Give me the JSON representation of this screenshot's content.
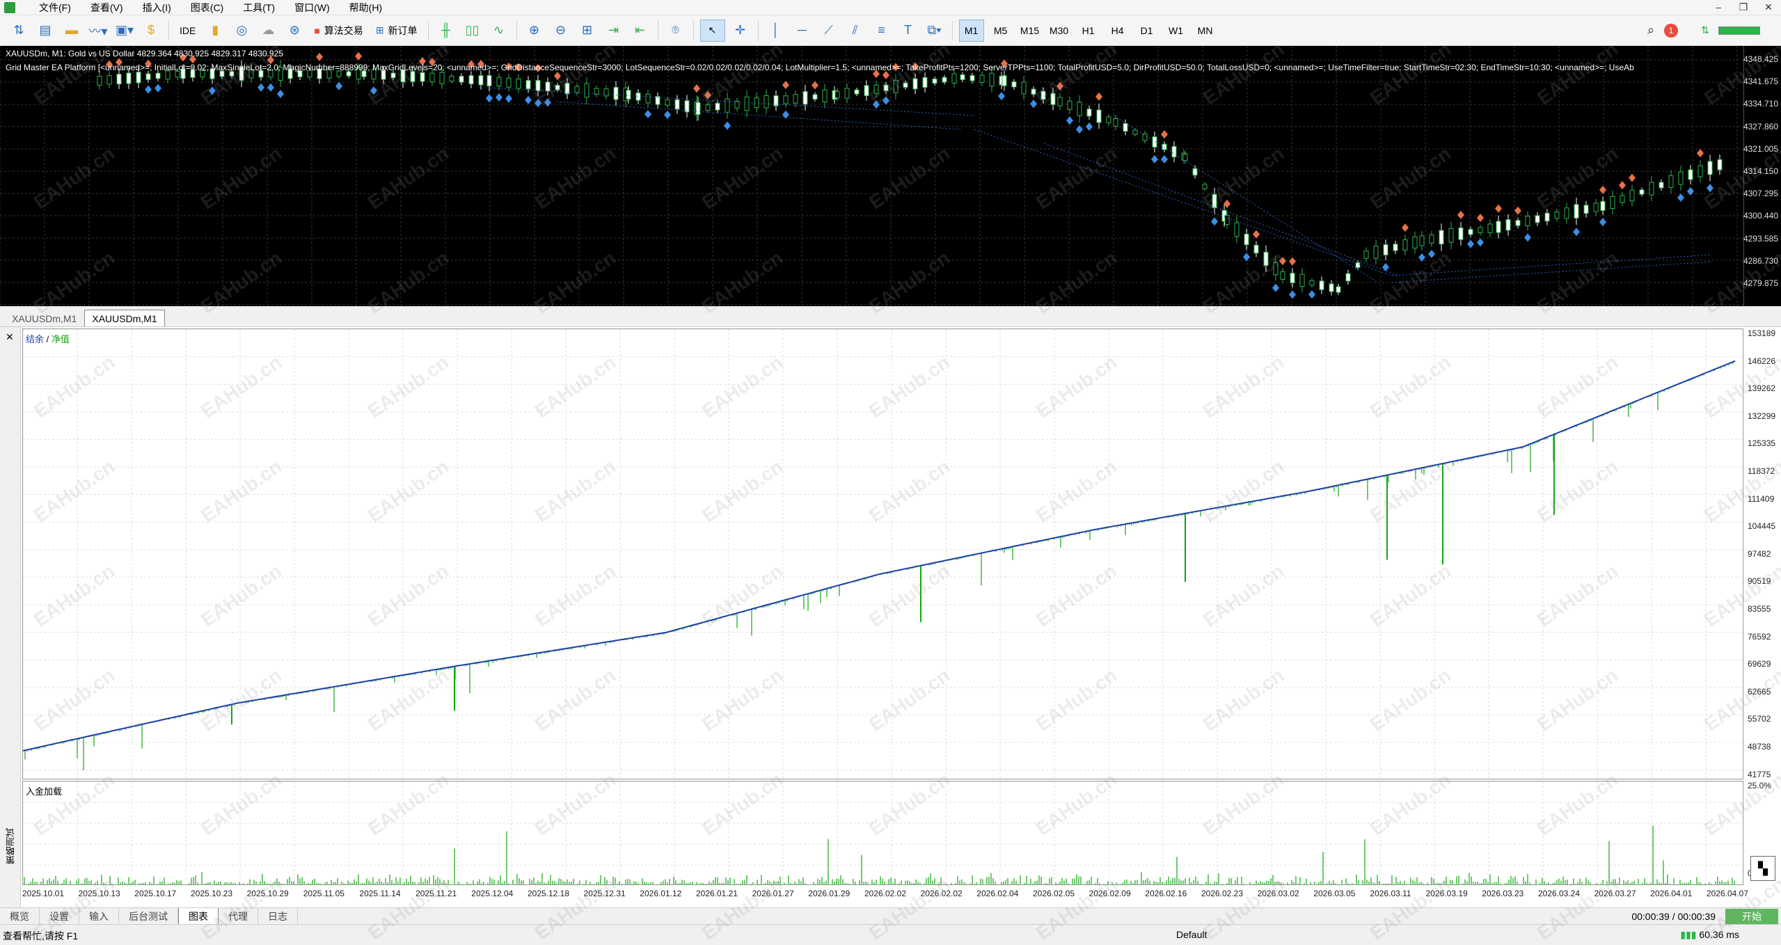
{
  "menu": [
    "文件(F)",
    "查看(V)",
    "插入(I)",
    "图表(C)",
    "工具(T)",
    "窗口(W)",
    "帮助(H)"
  ],
  "toolbar": {
    "ide_label": "IDE",
    "algo_trading_label": "算法交易",
    "new_order_label": "新订单",
    "timeframes": [
      "M1",
      "M5",
      "M15",
      "M30",
      "H1",
      "H4",
      "D1",
      "W1",
      "MN"
    ],
    "active_timeframe": "M1",
    "notification_count": "1"
  },
  "chart": {
    "symbol_line": "XAUUSDm, M1:  Gold vs US Dollar  4829.364 4830.925 4829.317 4830.925",
    "ea_line": "Grid Master EA Platform [<unnamed>=; InitialLot=0.02; MaxSingleLot=2.0; MagicNumber=888999; MaxGridLevels=20; <unnamed>=; GridDistanceSequenceStr=3000; LotSequenceStr=0.02/0.02/0.02/0.02/0.04; LotMultiplier=1.5; <unnamed>=; TakeProfitPts=1200; ServerTPPts=1100; TotalProfitUSD=5.0; DirProfitUSD=50.0; TotalLossUSD=0; <unnamed>=; UseTimeFilter=true; StartTimeStr=02:30; EndTimeStr=10:30; <unnamed>=; UseAb",
    "price_labels": [
      "4348.425",
      "4341.675",
      "4334.710",
      "4327.860",
      "4321.005",
      "4314.150",
      "4307.295",
      "4300.440",
      "4293.585",
      "4286.730",
      "4279.875"
    ],
    "bg_color": "#000000",
    "bull_color": "#2ab54a",
    "bear_color": "#ffffff"
  },
  "chart_tabs": [
    "XAUUSDm,M1",
    "XAUUSDm,M1"
  ],
  "active_chart_tab": 1,
  "tester": {
    "vertical_label": "策略测试",
    "legend_balance": "结余",
    "legend_sep": " / ",
    "legend_equity": "净值",
    "load_label": "入金加载",
    "balance_labels": [
      "153189",
      "146226",
      "139262",
      "132299",
      "125335",
      "118372",
      "111409",
      "104445",
      "97482",
      "90519",
      "83555",
      "76592",
      "69629",
      "62665",
      "55702",
      "48738",
      "41775"
    ],
    "load_labels": [
      "25.0%",
      "0.0%"
    ],
    "dates": [
      "2025.10.01",
      "2025.10.13",
      "2025.10.17",
      "2025.10.23",
      "2025.10.29",
      "2025.11.05",
      "2025.11.14",
      "2025.11.21",
      "2025.12.04",
      "2025.12.18",
      "2025.12.31",
      "2026.01.12",
      "2026.01.21",
      "2026.01.27",
      "2026.01.29",
      "2026.02.02",
      "2026.02.02",
      "2026.02.04",
      "2026.02.05",
      "2026.02.09",
      "2026.02.16",
      "2026.02.23",
      "2026.03.02",
      "2026.03.05",
      "2026.03.11",
      "2026.03.19",
      "2026.03.23",
      "2026.03.24",
      "2026.03.27",
      "2026.04.01",
      "2026.04.07"
    ]
  },
  "chart_data": {
    "type": "line",
    "series": [
      {
        "name": "结余",
        "color": "#1c3fa8"
      },
      {
        "name": "净值",
        "color": "#11a611"
      }
    ],
    "x": [
      "2025.10.01",
      "2025.11.05",
      "2025.12.04",
      "2026.01.12",
      "2026.02.02",
      "2026.02.16",
      "2026.03.05",
      "2026.03.19",
      "2026.04.07"
    ],
    "balance": [
      48700,
      60500,
      69500,
      78000,
      92500,
      103500,
      113000,
      124000,
      145500
    ],
    "ylim": [
      41775,
      153189
    ]
  },
  "bottom_tabs": [
    "概览",
    "设置",
    "输入",
    "后台测试",
    "图表",
    "代理",
    "日志"
  ],
  "active_bottom_tab": 4,
  "timer": "00:00:39 / 00:00:39",
  "start_label": "开始",
  "status": {
    "help": "查看帮忙,请按 F1",
    "profile": "Default",
    "ping": "60.36 ms"
  },
  "watermark": "EAHub.cn"
}
